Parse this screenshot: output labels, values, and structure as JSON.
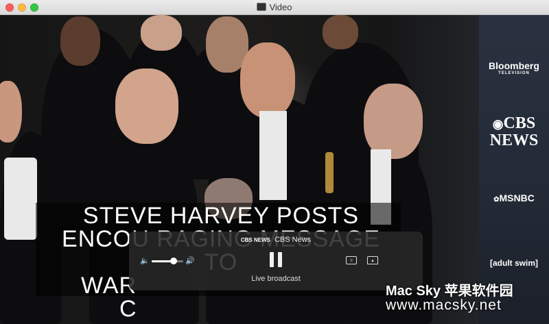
{
  "window": {
    "title": "Video"
  },
  "caption": {
    "lines": [
      "STEVE HARVEY POSTS",
      "ENCOU RAGING MESSAGE TO",
      "WAR",
      "C"
    ]
  },
  "player": {
    "channel": "CBS News",
    "channel_logo": "CBS NEWS",
    "status": "Live broadcast",
    "volume_level": 0.7
  },
  "sidebar": {
    "logos": [
      "Bloomberg",
      "TELEVISION",
      "CBS",
      "NEWS",
      "MSNBC",
      "[adult swim]"
    ]
  },
  "watermark": {
    "line1": "Mac Sky 苹果软件园",
    "line2": "www.macsky.net"
  },
  "colors": {
    "close": "#fc605c",
    "minimize": "#fdbc40",
    "maximize": "#34c84a"
  },
  "icons": [
    "volume-low-icon",
    "volume-high-icon",
    "pause-icon",
    "subtitles-icon",
    "airplay-icon",
    "app-icon"
  ]
}
